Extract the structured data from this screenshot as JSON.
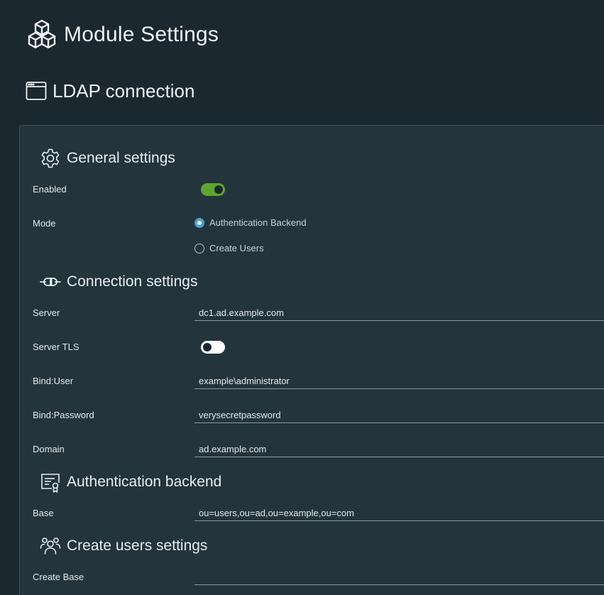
{
  "page": {
    "title": "Module Settings",
    "icon": "cubes-icon"
  },
  "section": {
    "title": "LDAP connection",
    "icon": "window-icon"
  },
  "general": {
    "title": "General settings",
    "icon": "gear-icon",
    "enabled_label": "Enabled",
    "enabled": true,
    "mode_label": "Mode",
    "mode_options": [
      "Authentication Backend",
      "Create Users"
    ],
    "mode_selected": "Authentication Backend"
  },
  "connection": {
    "title": "Connection settings",
    "icon": "plug-icon",
    "server_label": "Server",
    "server_value": "dc1.ad.example.com",
    "tls_label": "Server TLS",
    "tls_enabled": false,
    "bind_user_label": "Bind:User",
    "bind_user_value": "example\\administrator",
    "bind_password_label": "Bind:Password",
    "bind_password_value": "verysecretpassword",
    "domain_label": "Domain",
    "domain_value": "ad.example.com"
  },
  "auth_backend": {
    "title": "Authentication backend",
    "icon": "certificate-icon",
    "base_label": "Base",
    "base_value": "ou=users,ou=ad,ou=example,ou=com"
  },
  "create_users": {
    "title": "Create users settings",
    "icon": "users-icon",
    "create_base_label": "Create Base",
    "create_base_value": ""
  },
  "colors": {
    "background": "#1c2830",
    "card": "#23343c",
    "toggle_on": "#5ea62d",
    "radio_checked": "#49a2d3"
  }
}
